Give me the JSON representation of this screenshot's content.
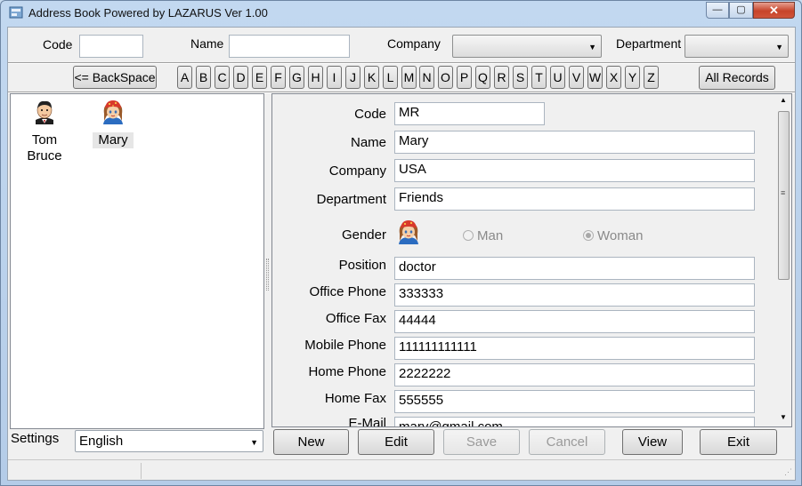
{
  "window": {
    "title": "Address Book Powered by LAZARUS  Ver 1.00",
    "minimize_glyph": "—",
    "maximize_glyph": "▢",
    "close_glyph": "✕"
  },
  "search": {
    "code_label": "Code",
    "code_value": "",
    "name_label": "Name",
    "name_value": "",
    "company_label": "Company",
    "company_value": "",
    "department_label": "Department",
    "department_value": ""
  },
  "alphabar": {
    "backspace_label": "<= BackSpace",
    "letters": [
      "A",
      "B",
      "C",
      "D",
      "E",
      "F",
      "G",
      "H",
      "I",
      "J",
      "K",
      "L",
      "M",
      "N",
      "O",
      "P",
      "Q",
      "R",
      "S",
      "T",
      "U",
      "V",
      "W",
      "X",
      "Y",
      "Z"
    ],
    "all_records_label": "All Records"
  },
  "contacts": [
    {
      "name_line1": "Tom",
      "name_line2": "Bruce",
      "avatar": "man-avatar-icon"
    },
    {
      "name_line1": "Mary",
      "name_line2": "",
      "avatar": "woman-avatar-icon"
    }
  ],
  "settings": {
    "label": "Settings",
    "language": "English"
  },
  "detail": {
    "code_label": "Code",
    "code_value": "MR",
    "name_label": "Name",
    "name_value": "Mary",
    "company_label": "Company",
    "company_value": "USA",
    "department_label": "Department",
    "department_value": "Friends",
    "gender_label": "Gender",
    "gender_man": "Man",
    "gender_woman": "Woman",
    "gender_selected": "Woman",
    "position_label": "Position",
    "position_value": "doctor",
    "office_phone_label": "Office Phone",
    "office_phone_value": "333333",
    "office_fax_label": "Office Fax",
    "office_fax_value": "44444",
    "mobile_phone_label": "Mobile Phone",
    "mobile_phone_value": "111111111111",
    "home_phone_label": "Home Phone",
    "home_phone_value": "2222222",
    "home_fax_label": "Home Fax",
    "home_fax_value": "555555",
    "email_label": "E-Mail",
    "email_value": "mary@gmail.com"
  },
  "actions": {
    "new_label": "New",
    "edit_label": "Edit",
    "save_label": "Save",
    "cancel_label": "Cancel",
    "view_label": "View",
    "exit_label": "Exit"
  }
}
